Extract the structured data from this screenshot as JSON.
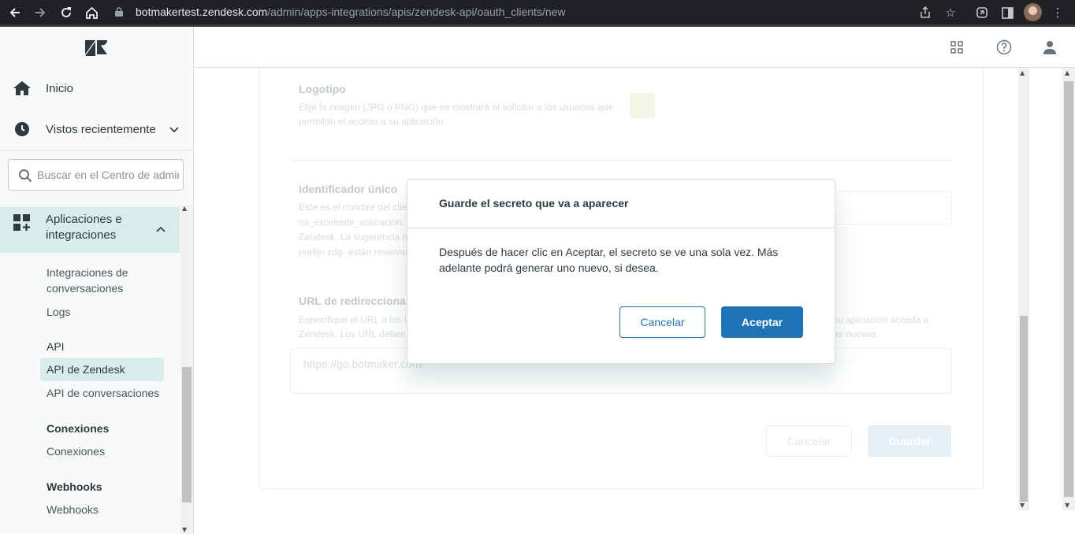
{
  "browser": {
    "url_host": "botmakertest.zendesk.com",
    "url_path": "/admin/apps-integrations/apis/zendesk-api/oauth_clients/new",
    "icons": [
      "back-icon",
      "forward-icon",
      "reload-icon",
      "home-icon",
      "lock-icon",
      "share-icon",
      "star-icon",
      "extension-icon",
      "sidepanel-icon",
      "profile-avatar",
      "menu-icon"
    ]
  },
  "sidebar": {
    "home": "Inicio",
    "recent": "Vistos recientemente",
    "search_placeholder": "Buscar en el Centro de administración",
    "apps_section": "Aplicaciones e integraciones",
    "items": [
      {
        "label": "Integraciones de conversaciones"
      },
      {
        "label": "Logs"
      }
    ],
    "api_heading": "API",
    "api_items": [
      {
        "label": "API de Zendesk",
        "active": true
      },
      {
        "label": "API de conversaciones"
      }
    ],
    "connections_heading": "Conexiones",
    "connections_item": "Conexiones",
    "webhooks_heading": "Webhooks",
    "webhooks_item": "Webhooks"
  },
  "header": {
    "icons": [
      "apps-grid-icon",
      "help-icon",
      "user-icon"
    ]
  },
  "form": {
    "logo_title": "Logotipo",
    "logo_help_1": "Elija la imagen (JPG o PNG) que se mostrará al solicitar a los usuarios que",
    "logo_help_2": "permitan el acceso a su aplicación.",
    "id_title": "Identificador único",
    "id_help_1": "Este es el nombre del cliente...",
    "id_help_2": "mi_excelente_aplicación. E...",
    "id_help_3": "Zendesk. La sugerencia m...",
    "id_help_4": "prefijo zdg- están reservad...",
    "redirect_title": "URL de redireccionamiento",
    "redirect_help_1": "Especifique el URL o los U...",
    "redirect_help_1b": "su aplicación acceda a",
    "redirect_help_2": "Zendesk. Los URL deben s...",
    "redirect_help_2b": "as nuevas.",
    "redirect_value": "https://go.botmaker.com/",
    "cancel_label": "Cancelar",
    "save_label": "Guardar"
  },
  "modal": {
    "title": "Guarde el secreto que va a aparecer",
    "body": "Después de hacer clic en Aceptar, el secreto se ve una sola vez. Más adelante podrá generar uno nuevo, si desea.",
    "cancel_label": "Cancelar",
    "ok_label": "Aceptar"
  },
  "colors": {
    "accent": "#1f73b7",
    "sidebar_active": "#d9ecec",
    "chrome_bg": "#202124"
  }
}
